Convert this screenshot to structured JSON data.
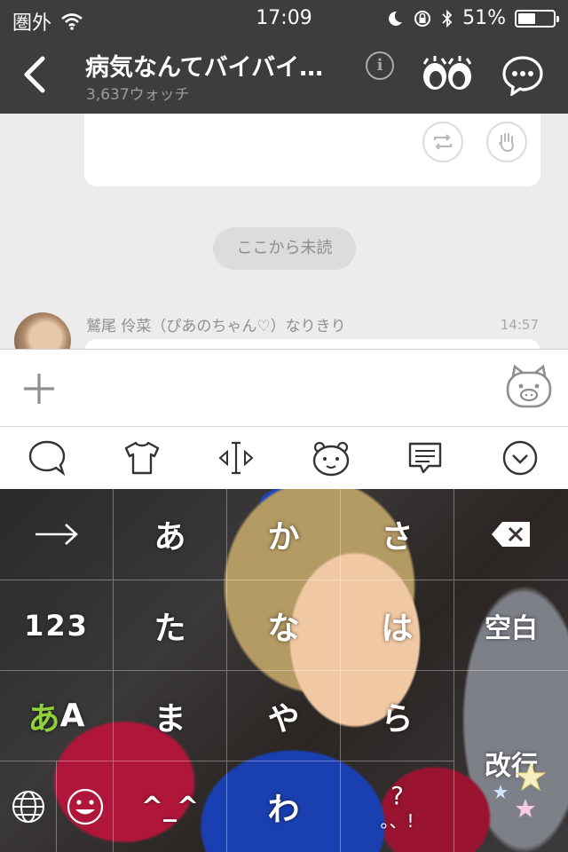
{
  "status_bar": {
    "carrier": "圏外",
    "time": "17:09",
    "battery": "51%",
    "battery_level": 0.51
  },
  "nav": {
    "title": "病気なんてバイバイ…",
    "subtitle": "3,637ウォッチ",
    "info_icon": "info-icon",
    "watch_icon": "eyes-icon",
    "menu_icon": "chat-bubble-menu-icon"
  },
  "chat": {
    "unread_divider": "ここから未読",
    "message": {
      "sender": "鷲尾 伶菜（ぴあのちゃん♡）なりきり",
      "time": "14:57"
    }
  },
  "keyboard_toolbar": {
    "icons": [
      "speech-bubble-icon",
      "shirt-icon",
      "cursor-move-icon",
      "bear-face-icon",
      "message-icon",
      "chevron-down-circle-icon"
    ]
  },
  "keyboard": {
    "rows": [
      [
        "→",
        "あ",
        "か",
        "さ",
        "⌫"
      ],
      [
        "123",
        "た",
        "な",
        "は",
        "空白"
      ],
      [
        "あA",
        "ま",
        "や",
        "ら",
        "改行"
      ],
      [
        "🌐",
        "☺",
        "^_^",
        "わ",
        "?。、!"
      ]
    ],
    "mode_key_primary": "あ",
    "mode_key_secondary": "A",
    "kaomoji_key": "^_^",
    "wa_key": "わ",
    "punct_key_top": "?",
    "punct_key_bottom": "。、!",
    "enter_key": "改行",
    "space_key": "空白",
    "number_key": "123",
    "accent_color": "#8fd13a"
  }
}
